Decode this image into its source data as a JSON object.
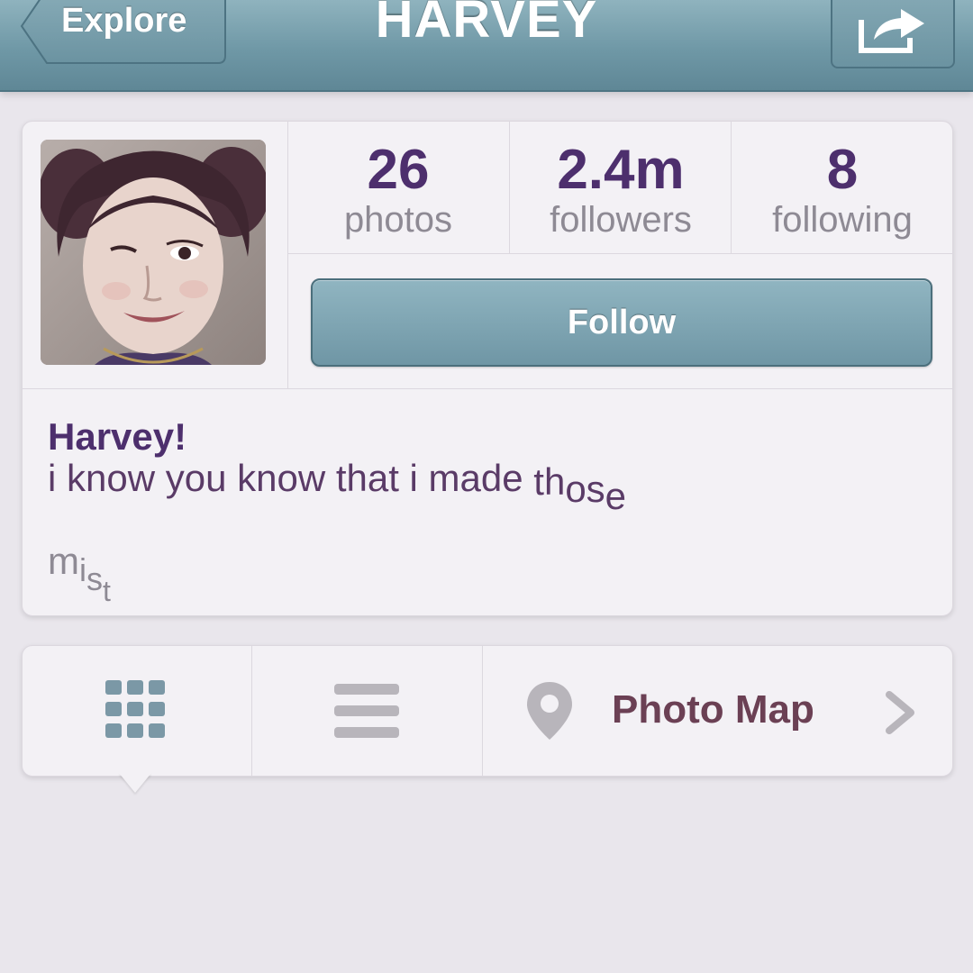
{
  "nav": {
    "back_label": "Explore",
    "title": "HARVEY",
    "share_icon": "share-icon"
  },
  "profile": {
    "stats": [
      {
        "value": "26",
        "label": "photos"
      },
      {
        "value": "2.4m",
        "label": "followers"
      },
      {
        "value": "8",
        "label": "following"
      }
    ],
    "follow_label": "Follow",
    "name": "Harvey!",
    "bio_words": [
      "i know you know that i made",
      "th",
      "os",
      "e"
    ],
    "bio_more": [
      "m",
      "i",
      "s",
      "t"
    ]
  },
  "tabs": {
    "grid_icon": "grid-icon",
    "list_icon": "list-icon",
    "map_icon": "location-pin-icon",
    "map_label": "Photo Map",
    "chevron_icon": "chevron-right-icon"
  },
  "colors": {
    "accent": "#6f98a6",
    "name": "#4d2f6d",
    "map_label": "#6b4054"
  }
}
